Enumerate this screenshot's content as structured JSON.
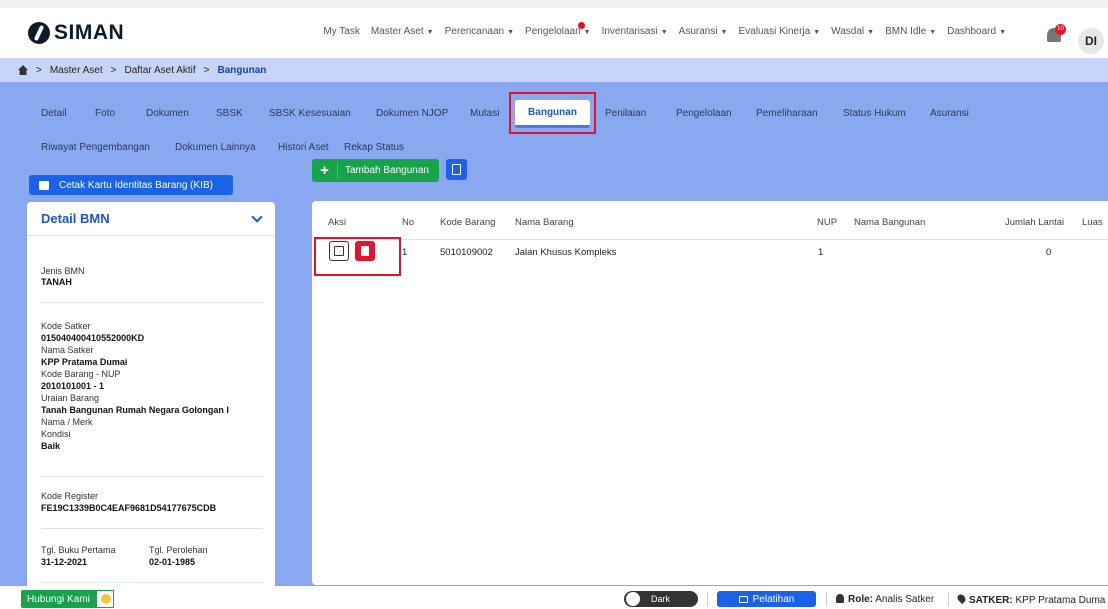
{
  "app": {
    "logo_text": "SIMAN",
    "avatar_initials": "DI",
    "notification_count": "10"
  },
  "menu": [
    {
      "label": "My Task",
      "dropdown": false
    },
    {
      "label": "Master Aset",
      "dropdown": true
    },
    {
      "label": "Perencanaan",
      "dropdown": true
    },
    {
      "label": "Pengelolaan",
      "dropdown": true,
      "dot": true
    },
    {
      "label": "Inventarisasi",
      "dropdown": true
    },
    {
      "label": "Asuransi",
      "dropdown": true
    },
    {
      "label": "Evaluasi Kinerja",
      "dropdown": true
    },
    {
      "label": "Wasdal",
      "dropdown": true
    },
    {
      "label": "BMN Idle",
      "dropdown": true
    },
    {
      "label": "Dashboard",
      "dropdown": true
    }
  ],
  "breadcrumb": {
    "items": [
      "Master Aset",
      "Daftar Aset Aktif",
      "Bangunan"
    ],
    "separator": ">"
  },
  "tabs": {
    "row1": [
      "Detail",
      "Foto",
      "Dokumen",
      "SBSK",
      "SBSK Kesesuaian",
      "Dokumen NJOP",
      "Mutasi",
      "Bangunan",
      "Penilaian",
      "Pengelolaan",
      "Pemeliharaan",
      "Status Hukum",
      "Asuransi"
    ],
    "row2": [
      "Riwayat Pengembangan",
      "Dokumen Lainnya",
      "Histori Aset",
      "Rekap Status"
    ],
    "active": "Bangunan"
  },
  "buttons": {
    "cetak_kib": "Cetak Kartu Identitas Barang (KIB)",
    "tambah_bangunan": "Tambah Bangunan",
    "plus": "+"
  },
  "detail_panel": {
    "title": "Detail BMN",
    "jenis_label": "Jenis BMN",
    "jenis_value": "TANAH",
    "kode_satker_label": "Kode Satker",
    "kode_satker_value": "015040400410552000KD",
    "nama_satker_label": "Nama Satker",
    "nama_satker_value": "KPP Pratama Dumai",
    "kode_barang_label": "Kode Barang - NUP",
    "kode_barang_value": "2010101001 - 1",
    "uraian_label": "Uraian Barang",
    "uraian_value": "Tanah Bangunan Rumah Negara Golongan I",
    "nama_merk_label": "Nama / Merk",
    "kondisi_label": "Kondisi",
    "kondisi_value": "Baik",
    "kode_register_label": "Kode Register",
    "kode_register_value": "FE19C1339B0C4EAF9681D54177675CDB",
    "tgl_buku_label": "Tgl. Buku Pertama",
    "tgl_buku_value": "31-12-2021",
    "tgl_perolehan_label": "Tgl. Perolehan",
    "tgl_perolehan_value": "02-01-1985"
  },
  "table": {
    "headers": [
      "Aksi",
      "No",
      "Kode Barang",
      "Nama Barang",
      "NUP",
      "Nama Bangunan",
      "Jumlah Lantai",
      "Luas"
    ],
    "rows": [
      {
        "no": "1",
        "kode_barang": "5010109002",
        "nama_barang": "Jalan Khusus Kompleks",
        "nup": "1",
        "nama_bangunan": "",
        "jumlah_lantai": "0"
      }
    ]
  },
  "footer": {
    "hubungi": "Hubungi Kami",
    "dark": "Dark",
    "pelatihan": "Pelatihan",
    "role_label": "Role:",
    "role_value": "Analis Satker",
    "satker_label": "SATKER:",
    "satker_value": "KPP Pratama Duma"
  },
  "colors": {
    "accent": "#1a62e8",
    "danger": "#e3122d",
    "success": "#16a34a",
    "background": "#8aa8ef"
  }
}
